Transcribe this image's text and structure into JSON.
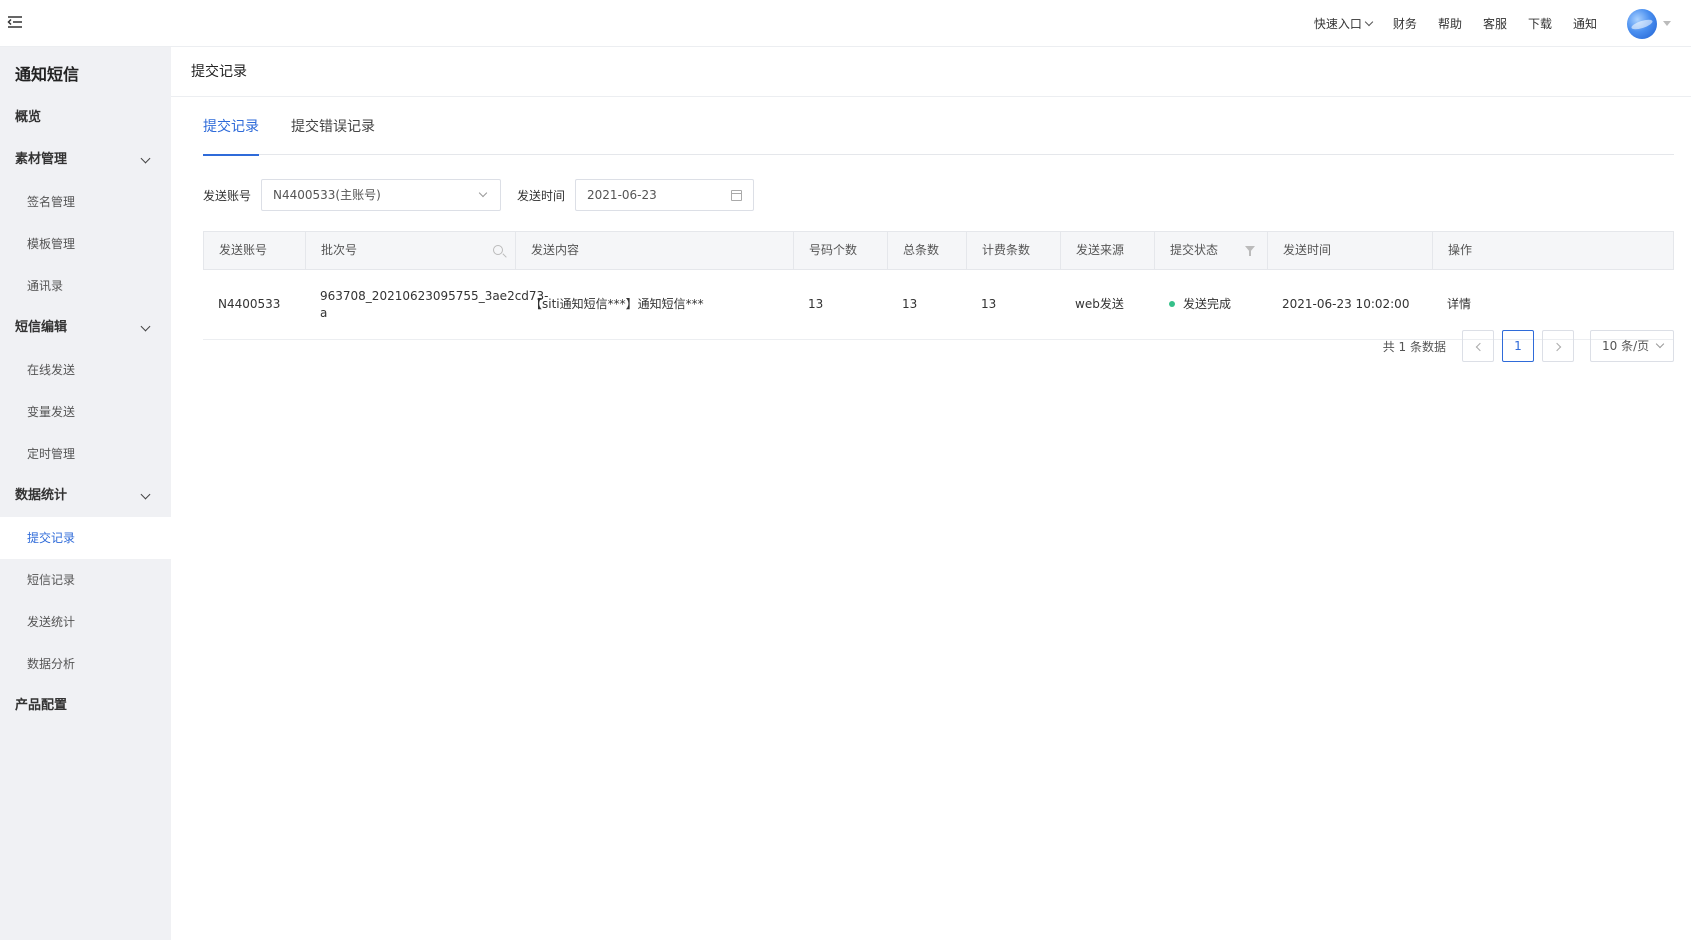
{
  "topbar": {
    "quick_entry": "快速入口",
    "nav": [
      "财务",
      "帮助",
      "客服",
      "下载",
      "通知"
    ]
  },
  "sidebar": {
    "app_title": "通知短信",
    "items": [
      {
        "label": "概览",
        "type": "group"
      },
      {
        "label": "素材管理",
        "type": "group"
      },
      {
        "label": "签名管理",
        "type": "sub"
      },
      {
        "label": "模板管理",
        "type": "sub"
      },
      {
        "label": "通讯录",
        "type": "sub"
      },
      {
        "label": "短信编辑",
        "type": "group"
      },
      {
        "label": "在线发送",
        "type": "sub"
      },
      {
        "label": "变量发送",
        "type": "sub"
      },
      {
        "label": "定时管理",
        "type": "sub"
      },
      {
        "label": "数据统计",
        "type": "group"
      },
      {
        "label": "提交记录",
        "type": "sub",
        "active": true
      },
      {
        "label": "短信记录",
        "type": "sub"
      },
      {
        "label": "发送统计",
        "type": "sub"
      },
      {
        "label": "数据分析",
        "type": "sub"
      },
      {
        "label": "产品配置",
        "type": "group"
      }
    ]
  },
  "page": {
    "title": "提交记录",
    "tabs": [
      {
        "label": "提交记录",
        "active": true
      },
      {
        "label": "提交错误记录"
      }
    ]
  },
  "filters": {
    "account_label": "发送账号",
    "account_value": "N4400533(主账号)",
    "time_label": "发送时间",
    "time_value": "2021-06-23"
  },
  "table": {
    "headers": [
      "发送账号",
      "批次号",
      "发送内容",
      "号码个数",
      "总条数",
      "计费条数",
      "发送来源",
      "提交状态",
      "发送时间",
      "操作"
    ],
    "rows": [
      {
        "account": "N4400533",
        "batch_line1": "963708_20210623095755_3ae2cd73-",
        "batch_line2": "a",
        "content": "【siti通知短信***】通知短信***",
        "numbers": "13",
        "total": "13",
        "billed": "13",
        "source": "web发送",
        "status": "发送完成",
        "time": "2021-06-23 10:02:00",
        "action": "详情"
      }
    ]
  },
  "pagination": {
    "total_text": "共 1 条数据",
    "current_page": "1",
    "page_size": "10 条/页"
  },
  "colors": {
    "accent": "#2f6bd9",
    "status_success": "#35c08a",
    "sidebar_bg": "#f0f1f4"
  }
}
